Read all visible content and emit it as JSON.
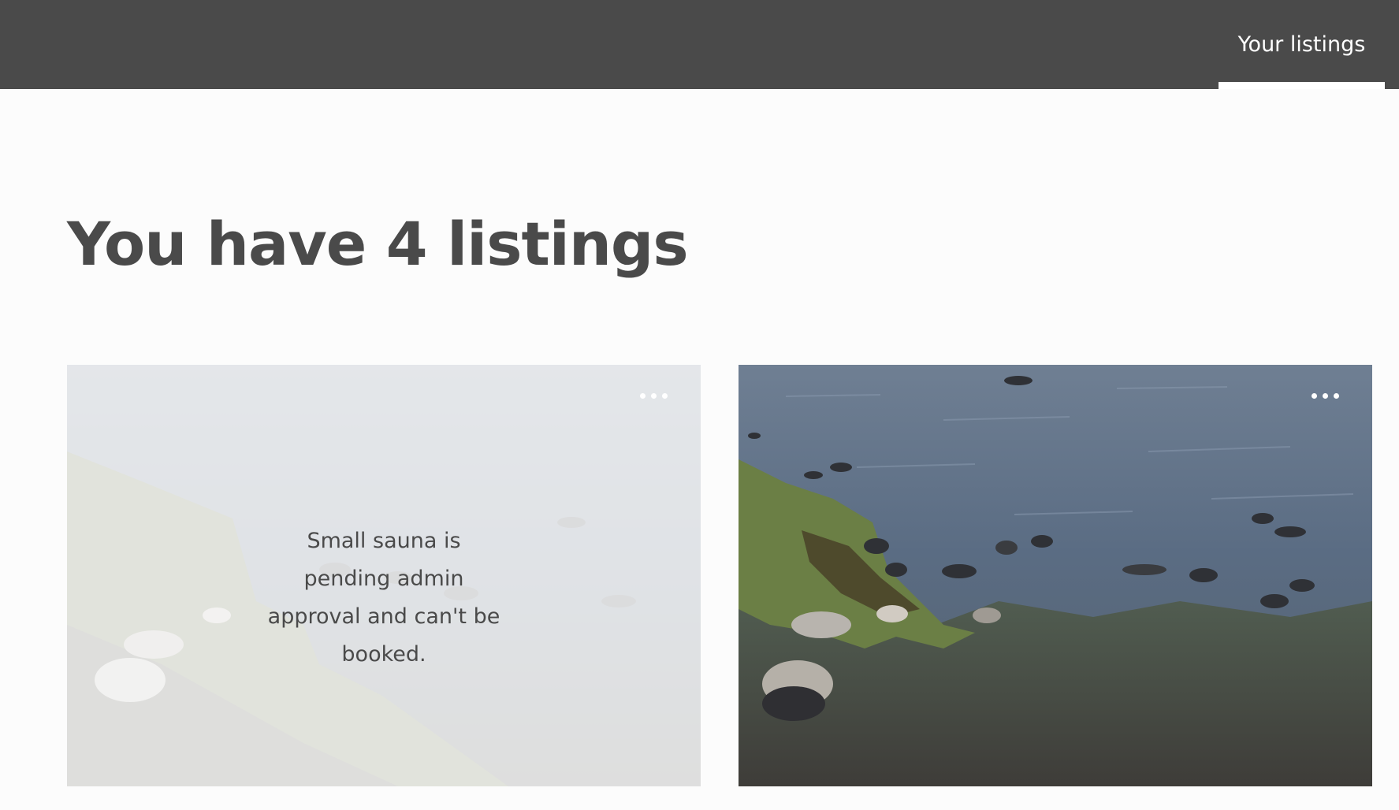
{
  "topbar": {
    "tab_label": "Your listings",
    "background": "#4a4a4a"
  },
  "main": {
    "title": "You have 4 listings"
  },
  "listings": [
    {
      "status_message": "Small sauna is pending admin approval and can't be booked.",
      "menu_icon": "more-dots-icon"
    },
    {
      "menu_icon": "more-dots-icon"
    }
  ]
}
